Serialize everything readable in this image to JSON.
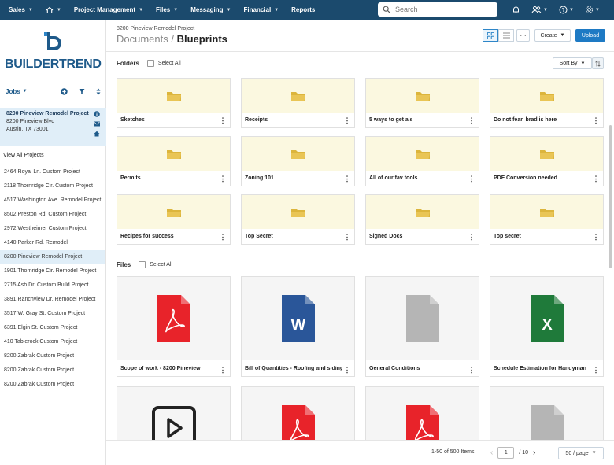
{
  "nav": {
    "items": [
      {
        "label": "Sales",
        "has_chevron": true
      },
      {
        "label": "",
        "icon": "home-icon",
        "has_chevron": true
      },
      {
        "label": "Project Management",
        "has_chevron": true
      },
      {
        "label": "Files",
        "has_chevron": true
      },
      {
        "label": "Messaging",
        "has_chevron": true
      },
      {
        "label": "Financial",
        "has_chevron": true
      },
      {
        "label": "Reports",
        "has_chevron": false
      }
    ],
    "search_placeholder": "Search",
    "right_icons": [
      "bell-icon",
      "users-icon",
      "help-icon",
      "settings-icon"
    ]
  },
  "sidebar": {
    "logo_text": "BUILDERTREND",
    "jobs_label": "Jobs",
    "current_project": {
      "name": "8200 Pineview Remodel Project",
      "address": "8200 Pineview Blvd",
      "city": "Austin, TX 73001"
    },
    "view_all_label": "View All Projects",
    "projects": [
      "2464 Royal Ln. Custom Project",
      "2118 Thornridge Cir. Custom Project",
      "4517 Washington Ave. Remodel Project",
      "8502 Preston Rd. Custom Project",
      "2972 Westheimer Custom Project",
      "4140 Parker Rd. Remodel",
      "8200 Pineview Remodel Project",
      "1901 Thornridge Cir. Remodel Project",
      "2715 Ash Dr. Custom Build Project",
      "3891 Ranchview Dr. Remodel Project",
      "3517 W. Gray St. Custom Project",
      "6391 Elgin St. Custom Project",
      "410 Tablerock Custom Project",
      "8200 Zabrak Custom Project",
      "8200 Zabrak Custom Project",
      "8200 Zabrak Custom Project"
    ],
    "active_project_index": 6
  },
  "header": {
    "project_name": "8200 Pineview Remodel Project",
    "breadcrumb_parent": "Documents",
    "breadcrumb_separator": " / ",
    "breadcrumb_current": "Blueprints",
    "more_label": "···",
    "create_label": "Create",
    "upload_label": "Upload"
  },
  "folders_section": {
    "title": "Folders",
    "select_all_label": "Select All",
    "sort_label": "Sort By",
    "folders": [
      "Sketches",
      "Receipts",
      "5 ways to get a's",
      "Do not fear, brad is here",
      "Permits",
      "Zoning 101",
      "All of our fav tools",
      "PDF Conversion needed",
      "Recipes for success",
      "Top Secret",
      "Signed Docs",
      "Top secret"
    ]
  },
  "files_section": {
    "title": "Files",
    "select_all_label": "Select All",
    "files": [
      {
        "name": "Scope of work - 8200 Pineview",
        "type": "pdf"
      },
      {
        "name": "Bill of Quantities - Roofing and siding",
        "type": "word"
      },
      {
        "name": "General Conditions",
        "type": "generic"
      },
      {
        "name": "Schedule Estimation for Handyman",
        "type": "excel"
      },
      {
        "name": "",
        "type": "video"
      },
      {
        "name": "",
        "type": "pdf"
      },
      {
        "name": "",
        "type": "pdf"
      },
      {
        "name": "",
        "type": "generic"
      }
    ]
  },
  "pagination": {
    "count_text": "1-50 of 500 Items",
    "current_page": "1",
    "total_pages_text": "/ 10",
    "per_page_label": "50 / page"
  },
  "colors": {
    "nav_bg": "#1b4a6d",
    "brand_blue": "#1e5a8a",
    "accent": "#1e7ac4",
    "folder_bg": "#fbf8e0",
    "folder_icon": "#dcb53c",
    "pdf": "#e8232a",
    "word": "#2a5699",
    "excel": "#1f7a3a",
    "generic": "#b5b5b5"
  }
}
